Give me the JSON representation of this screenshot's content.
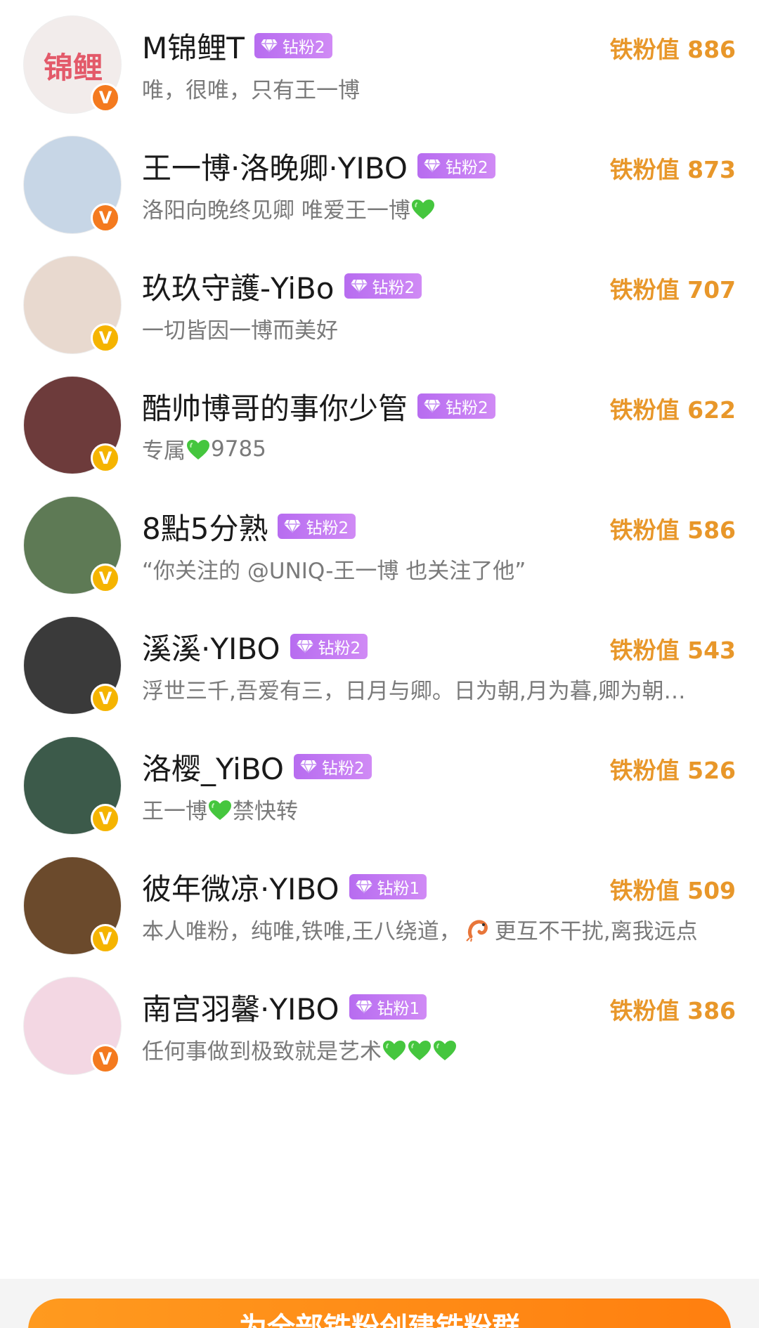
{
  "fans": [
    {
      "name": "M锦鲤T",
      "rank": "钻粉2",
      "score_label": "铁粉值 886",
      "bio": "唯，很唯，只有王一博",
      "hearts": 0,
      "badge": "orange",
      "avatar_text": "锦鲤",
      "avatar_color": "#f2eceb"
    },
    {
      "name": "王一博·洛晚卿·YIBO",
      "rank": "钻粉2",
      "score_label": "铁粉值 873",
      "bio": "洛阳向晚终见卿 唯爱王一博",
      "hearts": 1,
      "badge": "orange",
      "avatar_text": "",
      "avatar_color": "#c7d6e6"
    },
    {
      "name": "玖玖守護-YiBo",
      "rank": "钻粉2",
      "score_label": "铁粉值 707",
      "bio": "一切皆因一博而美好",
      "hearts": 0,
      "badge": "yellow",
      "avatar_text": "",
      "avatar_color": "#e8d9cf"
    },
    {
      "name": "酷帅博哥的事你少管",
      "rank": "钻粉2",
      "score_label": "铁粉值 622",
      "bio": "专属",
      "bio_after": "9785",
      "hearts": 1,
      "badge": "yellow",
      "avatar_text": "",
      "avatar_color": "#6d3b3b"
    },
    {
      "name": "8點5分熟",
      "rank": "钻粉2",
      "score_label": "铁粉值 586",
      "bio": "“你关注的 @UNIQ-王一博 也关注了他”",
      "hearts": 0,
      "badge": "yellow",
      "avatar_text": "",
      "avatar_color": "#5e7a55"
    },
    {
      "name": "溪溪·YIBO",
      "rank": "钻粉2",
      "score_label": "铁粉值 543",
      "bio": "浮世三千,吾爱有三，日月与卿。日为朝,月为暮,卿为朝…",
      "hearts": 0,
      "badge": "yellow",
      "avatar_text": "",
      "avatar_color": "#3a3a3a"
    },
    {
      "name": "洛樱_YiBO",
      "rank": "钻粉2",
      "score_label": "铁粉值 526",
      "bio": "王一博",
      "bio_after": " 禁快转",
      "hearts": 1,
      "badge": "yellow",
      "avatar_text": "",
      "avatar_color": "#3c5a4a"
    },
    {
      "name": "彼年微凉·YIBO",
      "rank": "钻粉1",
      "score_label": "铁粉值 509",
      "bio": "本人唯粉，纯唯,铁唯,王八绕道，",
      "bio_after": "更互不干扰,离我远点",
      "hearts": 0,
      "shrimp": true,
      "badge": "yellow",
      "avatar_text": "",
      "avatar_color": "#6b4a2c"
    },
    {
      "name": "南宫羽馨·YIBO",
      "rank": "钻粉1",
      "score_label": "铁粉值 386",
      "bio": "任何事做到极致就是艺术",
      "hearts": 3,
      "badge": "orange",
      "avatar_text": "",
      "avatar_color": "#f3d7e3"
    }
  ],
  "cta": {
    "label": "为全部铁粉创建铁粉群"
  },
  "colors": {
    "score": "#e8972a",
    "rank_badge": "#c17cf2",
    "verified_orange": "#f47a1f",
    "verified_yellow": "#f5b400",
    "heart": "#45c63e"
  }
}
